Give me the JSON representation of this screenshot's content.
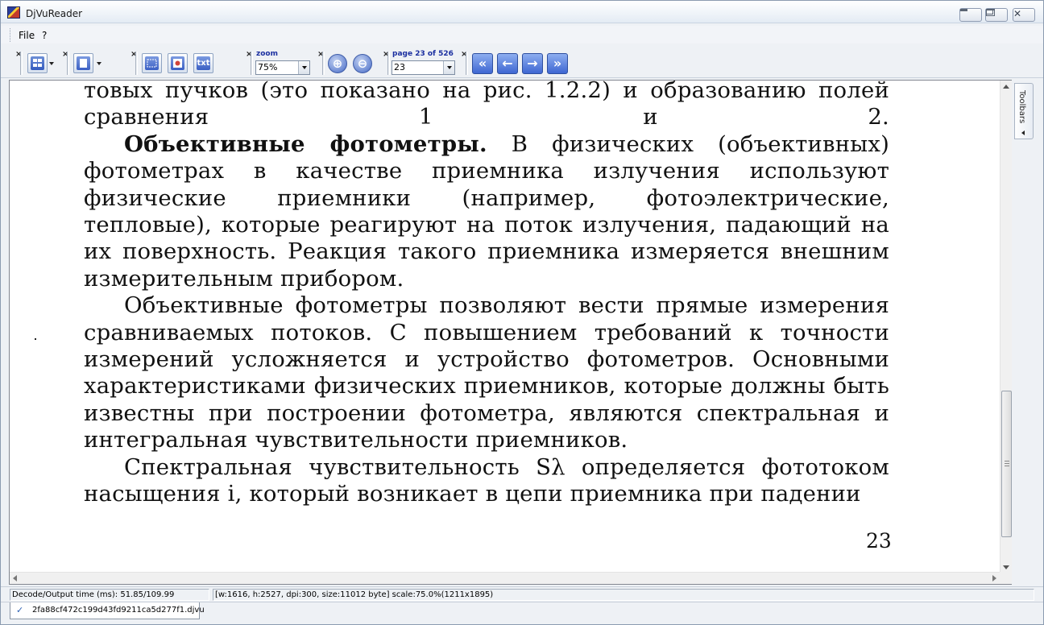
{
  "window": {
    "title": "DjVuReader",
    "controls": {
      "minimize": "",
      "maximize": "",
      "close": "✕"
    }
  },
  "menubar": {
    "items": [
      {
        "label": "File"
      },
      {
        "label": "?"
      }
    ]
  },
  "toolbar": {
    "close_glyph": "×",
    "view_mode_icon": "thumbnails-icon",
    "page_icon": "page-icon",
    "select_icon": "select-area-icon",
    "image_icon": "image-icon",
    "text_button": "txt",
    "zoom": {
      "label": "zoom",
      "value": "75%"
    },
    "zoom_in": "⊕",
    "zoom_out": "⊖",
    "page": {
      "label": "page 23 of 526",
      "value": "23"
    },
    "nav": {
      "first": "«",
      "prev": "←",
      "next": "→",
      "last": "»"
    }
  },
  "document": {
    "paragraphs": [
      {
        "text": "товых пучков (это показано на рис. 1.2.2) и образованию полей сравнения 1 и 2."
      },
      {
        "bold": "Объективные фотометры.",
        "text": " В физических (объективных) фотометрах в качестве приемника излучения используют физические приемники (например, фотоэлектрические, тепловые), которые реагируют на поток излучения, падающий на их поверхность. Реакция такого приемника измеряется внешним измерительным прибором."
      },
      {
        "text": "Объективные фотометры позволяют вести прямые измерения сравниваемых потоков. С повышением требований к точности измерений усложняется и устройство фотометров. Основными характеристиками физических приемников, которые должны быть известны при построении фотометра, являются спектральная и интегральная чувствительности приемников."
      },
      {
        "text": "Спектральная чувствительность Sλ определяется фототоком насыщения i, который возникает в цепи приемника при падении"
      }
    ],
    "page_number": "23"
  },
  "side_panel": {
    "label": "Toolbars"
  },
  "statusbar": {
    "decode_time": "Decode/Output time (ms): 51.85/109.99",
    "page_info": "[w:1616, h:2527, dpi:300, size:11012 byte] scale:75.0%(1211x1895)"
  },
  "tabs": [
    {
      "label": "2fa88cf472c199d43fd9211ca5d277f1.djvu",
      "icon": "check-icon"
    }
  ]
}
